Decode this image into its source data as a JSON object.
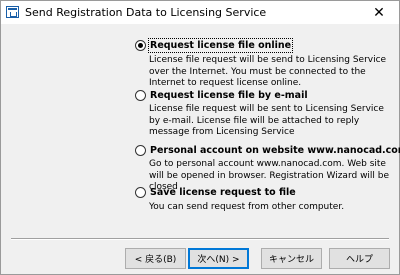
{
  "window": {
    "title": "Send Registration Data to Licensing Service",
    "close_symbol": "✕"
  },
  "options": [
    {
      "label": "Request license file online",
      "checked": true,
      "description": "License file request will be send to Licensing Service over the Internet. You must be connected to the Internet to request license online."
    },
    {
      "label": "Request license file by e-mail",
      "checked": false,
      "description": "License file request will be sent to Licensing Service by e-mail. License file will be attached to reply message from Licensing Service"
    },
    {
      "label": "Personal account on website www.nanocad.com",
      "checked": false,
      "description": "Go to personal account www.nanocad.com. Web site will be opened in browser. Registration Wizard will be closed"
    },
    {
      "label": "Save license request to file",
      "checked": false,
      "description": "You can send request from other computer."
    }
  ],
  "buttons": {
    "back": "< 戻る(B)",
    "next": "次へ(N) >",
    "cancel": "キャンセル",
    "help": "ヘルプ"
  }
}
